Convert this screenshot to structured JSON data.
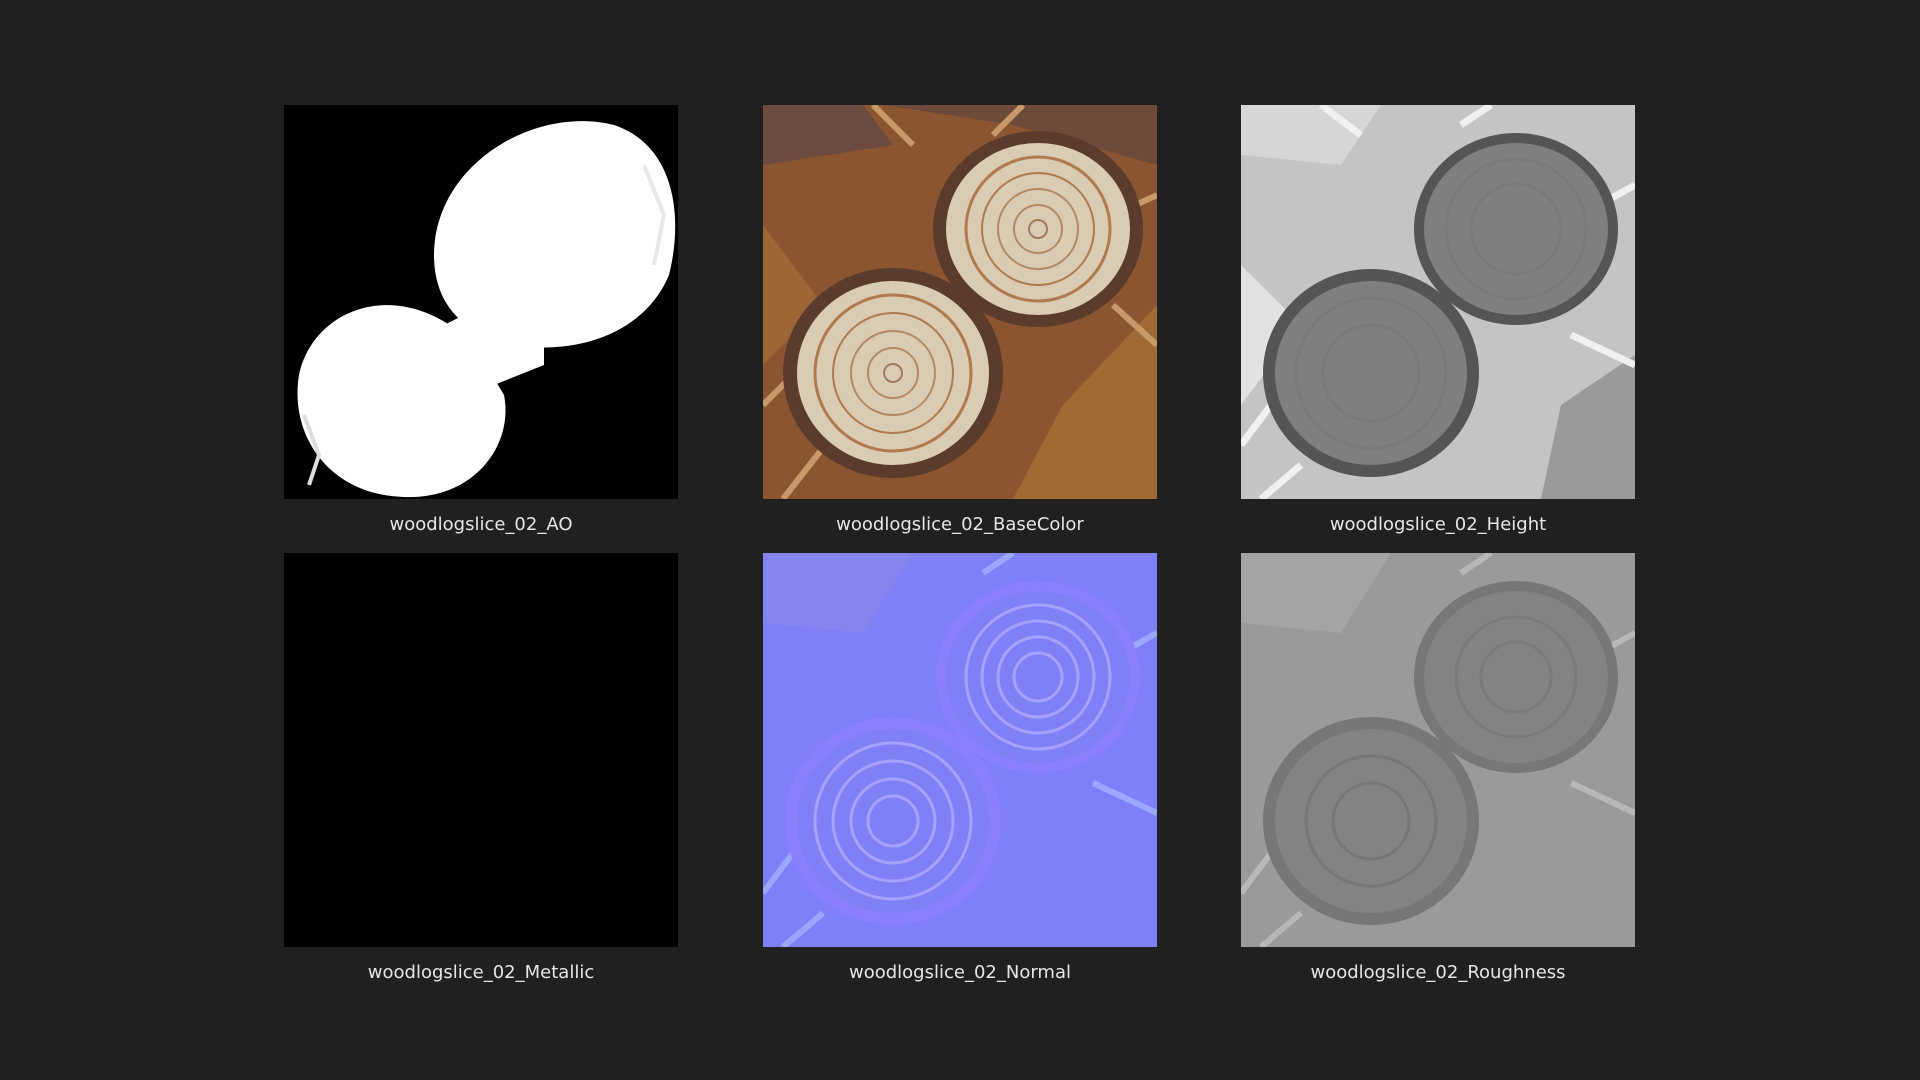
{
  "thumbnails": [
    {
      "name": "woodlogslice_02_AO",
      "map": "ambient-occlusion"
    },
    {
      "name": "woodlogslice_02_BaseColor",
      "map": "base-color"
    },
    {
      "name": "woodlogslice_02_Height",
      "map": "height"
    },
    {
      "name": "woodlogslice_02_Metallic",
      "map": "metallic"
    },
    {
      "name": "woodlogslice_02_Normal",
      "map": "normal"
    },
    {
      "name": "woodlogslice_02_Roughness",
      "map": "roughness"
    }
  ],
  "colors": {
    "background": "#202020",
    "caption": "#e6e6e6",
    "ao_bg": "#000000",
    "ao_fg": "#ffffff",
    "basecolor_bg": "#8a5530",
    "basecolor_wood": "#d9cbb4",
    "basecolor_ring": "#b07a4e",
    "height_bg": "#c4c4c4",
    "height_disc": "#7f7f7f",
    "metallic": "#000000",
    "normal_bg": "#7f7ff7",
    "normal_ring": "#a7a0ff",
    "roughness_bg": "#9a9a9a",
    "roughness_disc": "#838383"
  }
}
